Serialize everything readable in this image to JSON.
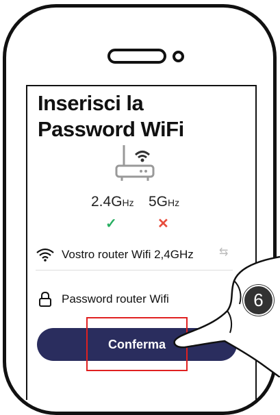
{
  "title": "Inserisci la Password WiFi",
  "bands": [
    {
      "label": "2.4G",
      "unit": "Hz",
      "status": "✓",
      "status_color": "#27ae60"
    },
    {
      "label": "5G",
      "unit": "Hz",
      "status": "✕",
      "status_color": "#e74c3c"
    }
  ],
  "wifi_row": {
    "icon": "wifi-icon",
    "label": "Vostro router Wifi 2,4GHz",
    "swap_icon": "swap-icon"
  },
  "password_row": {
    "icon": "lock-icon",
    "placeholder": "Password router Wifi"
  },
  "confirm_button": {
    "label": "Conferma",
    "color": "#2a2d5e"
  },
  "step_badge": "6",
  "highlight_color": "#e02020"
}
